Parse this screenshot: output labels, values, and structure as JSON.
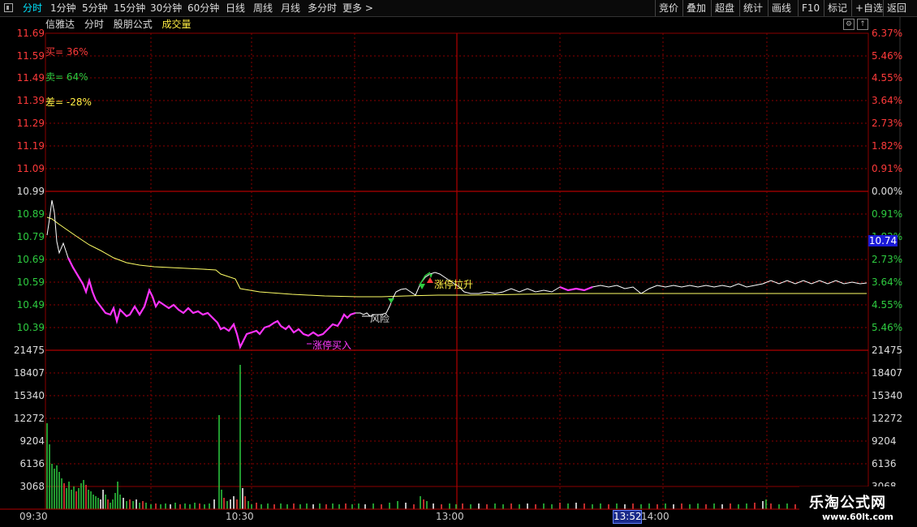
{
  "toolbar": {
    "left_items": [
      "分时",
      "1分钟",
      "5分钟",
      "15分钟",
      "30分钟",
      "60分钟",
      "日线",
      "周线",
      "月线",
      "多分时",
      "更多 >"
    ],
    "right_items": [
      "竞价",
      "叠加",
      "超盘",
      "统计",
      "画线",
      "F10",
      "标记",
      "+自选",
      "返回"
    ]
  },
  "header": {
    "stock_name": "信雅达",
    "view": "分时",
    "formula": "股朋公式",
    "volume_label": "成交量"
  },
  "indicators": {
    "buy": "买= 36%",
    "sell": "卖= 64%",
    "diff": "差= -28%"
  },
  "price_axis_left": [
    "11.69",
    "11.59",
    "11.49",
    "11.39",
    "11.29",
    "11.19",
    "11.09",
    "10.99",
    "10.89",
    "10.79",
    "10.69",
    "10.59",
    "10.49",
    "10.39"
  ],
  "pct_axis_right": [
    "6.37%",
    "5.46%",
    "4.55%",
    "3.64%",
    "2.73%",
    "1.82%",
    "0.91%",
    "0.00%",
    "0.91%",
    "1.82%",
    "2.73%",
    "3.64%",
    "4.55%",
    "5.46%"
  ],
  "volume_axis": [
    "21475",
    "18407",
    "15340",
    "12272",
    "9204",
    "6136",
    "3068"
  ],
  "time_labels": [
    "09:30",
    "10:30",
    "13:00",
    "14:00"
  ],
  "current_time": "13:52",
  "current_price": "10.74",
  "annotations": {
    "risk": "风险",
    "limit_up_rise": "涨停拉升",
    "limit_up_buy": "涨停买入"
  },
  "logo": {
    "title": "乐淘公式网",
    "url": "www.60lt.com"
  },
  "colors": {
    "background": "#000000",
    "grid": "#8b0000",
    "price_line": "#ffffff",
    "avg_line": "#ffff66",
    "highlight": "#ff33ff",
    "up": "#ff3a3a",
    "down": "#2ecc40"
  }
}
